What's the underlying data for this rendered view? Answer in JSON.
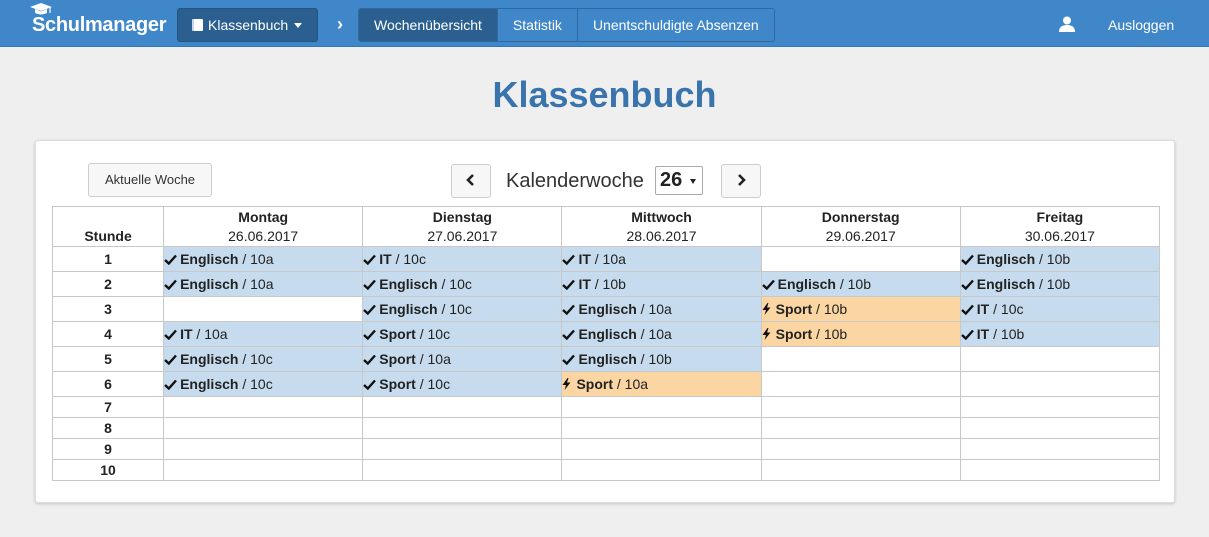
{
  "nav": {
    "brand": "Schulmanager",
    "klassenbuch_label": "Klassenbuch",
    "tabs": [
      {
        "label": "Wochenübersicht",
        "active": true
      },
      {
        "label": "Statistik",
        "active": false
      },
      {
        "label": "Unentschuldigte Absenzen",
        "active": false
      }
    ],
    "logout_label": "Ausloggen"
  },
  "page": {
    "title": "Klassenbuch",
    "current_week_button": "Aktuelle Woche",
    "week_label": "Kalenderwoche",
    "week_value": "26"
  },
  "colors": {
    "navbar": "#3f87c9",
    "title": "#3a74ad",
    "lesson_done": "#c6dcee",
    "lesson_substitute": "#fcd6a2"
  },
  "timetable": {
    "hour_header": "Stunde",
    "days": [
      {
        "name": "Montag",
        "date": "26.06.2017"
      },
      {
        "name": "Dienstag",
        "date": "27.06.2017"
      },
      {
        "name": "Mittwoch",
        "date": "28.06.2017"
      },
      {
        "name": "Donnerstag",
        "date": "29.06.2017"
      },
      {
        "name": "Freitag",
        "date": "30.06.2017"
      }
    ],
    "rows": [
      {
        "hour": "1",
        "cells": [
          {
            "subject": "Englisch",
            "klass": " / 10a",
            "status": "done"
          },
          {
            "subject": "IT",
            "klass": " / 10c",
            "status": "done"
          },
          {
            "subject": "IT",
            "klass": " / 10a",
            "status": "done"
          },
          null,
          {
            "subject": "Englisch",
            "klass": " / 10b",
            "status": "done"
          }
        ]
      },
      {
        "hour": "2",
        "cells": [
          {
            "subject": "Englisch",
            "klass": " / 10a",
            "status": "done"
          },
          {
            "subject": "Englisch",
            "klass": " / 10c",
            "status": "done"
          },
          {
            "subject": "IT",
            "klass": " / 10b",
            "status": "done"
          },
          {
            "subject": "Englisch",
            "klass": " / 10b",
            "status": "done"
          },
          {
            "subject": "Englisch",
            "klass": " / 10b",
            "status": "done"
          }
        ]
      },
      {
        "hour": "3",
        "cells": [
          null,
          {
            "subject": "Englisch",
            "klass": " / 10c",
            "status": "done"
          },
          {
            "subject": "Englisch",
            "klass": " / 10a",
            "status": "done"
          },
          {
            "subject": "Sport",
            "klass": " / 10b",
            "status": "substitute"
          },
          {
            "subject": "IT",
            "klass": " / 10c",
            "status": "done"
          }
        ]
      },
      {
        "hour": "4",
        "cells": [
          {
            "subject": "IT",
            "klass": " / 10a",
            "status": "done"
          },
          {
            "subject": "Sport",
            "klass": " / 10c",
            "status": "done"
          },
          {
            "subject": "Englisch",
            "klass": " / 10a",
            "status": "done"
          },
          {
            "subject": "Sport",
            "klass": " / 10b",
            "status": "substitute"
          },
          {
            "subject": "IT",
            "klass": " / 10b",
            "status": "done"
          }
        ]
      },
      {
        "hour": "5",
        "cells": [
          {
            "subject": "Englisch",
            "klass": " / 10c",
            "status": "done"
          },
          {
            "subject": "Sport",
            "klass": " / 10a",
            "status": "done"
          },
          {
            "subject": "Englisch",
            "klass": " / 10b",
            "status": "done"
          },
          null,
          null
        ]
      },
      {
        "hour": "6",
        "cells": [
          {
            "subject": "Englisch",
            "klass": " / 10c",
            "status": "done"
          },
          {
            "subject": "Sport",
            "klass": " / 10c",
            "status": "done"
          },
          {
            "subject": "Sport",
            "klass": " / 10a",
            "status": "substitute"
          },
          null,
          null
        ]
      },
      {
        "hour": "7",
        "cells": [
          null,
          null,
          null,
          null,
          null
        ]
      },
      {
        "hour": "8",
        "cells": [
          null,
          null,
          null,
          null,
          null
        ]
      },
      {
        "hour": "9",
        "cells": [
          null,
          null,
          null,
          null,
          null
        ]
      },
      {
        "hour": "10",
        "cells": [
          null,
          null,
          null,
          null,
          null
        ]
      }
    ]
  }
}
